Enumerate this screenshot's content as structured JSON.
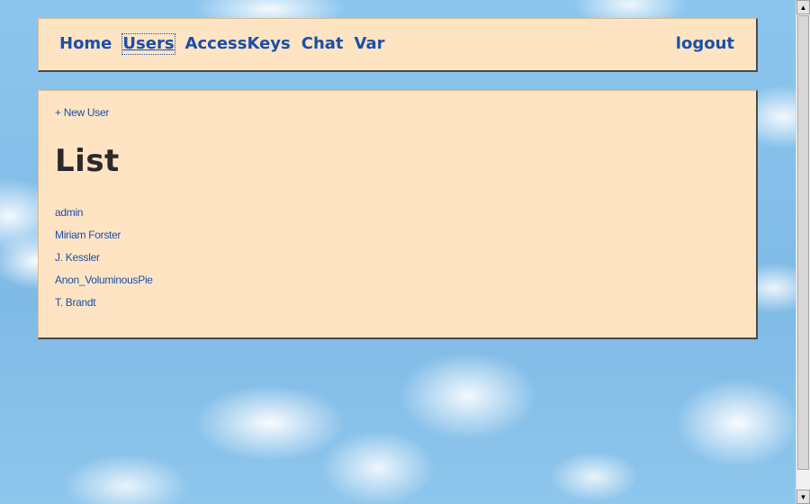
{
  "nav": {
    "items": [
      {
        "label": "Home"
      },
      {
        "label": "Users"
      },
      {
        "label": "AccessKeys"
      },
      {
        "label": "Chat"
      },
      {
        "label": "Var"
      }
    ],
    "active": "Users",
    "logout_label": "logout"
  },
  "content": {
    "new_user_label": "+ New User",
    "title": "List",
    "users": [
      {
        "name": "admin"
      },
      {
        "name": "Miriam Forster"
      },
      {
        "name": "J. Kessler"
      },
      {
        "name": "Anon_VoluminousPie"
      },
      {
        "name": "T. Brandt"
      }
    ]
  },
  "colors": {
    "panel_bg": "#ffe4c4",
    "link": "#1b4fa8",
    "title": "#2a2a2a"
  },
  "icons": {
    "scroll_up": "scroll-up-arrow-icon",
    "scroll_down": "scroll-down-arrow-icon"
  }
}
